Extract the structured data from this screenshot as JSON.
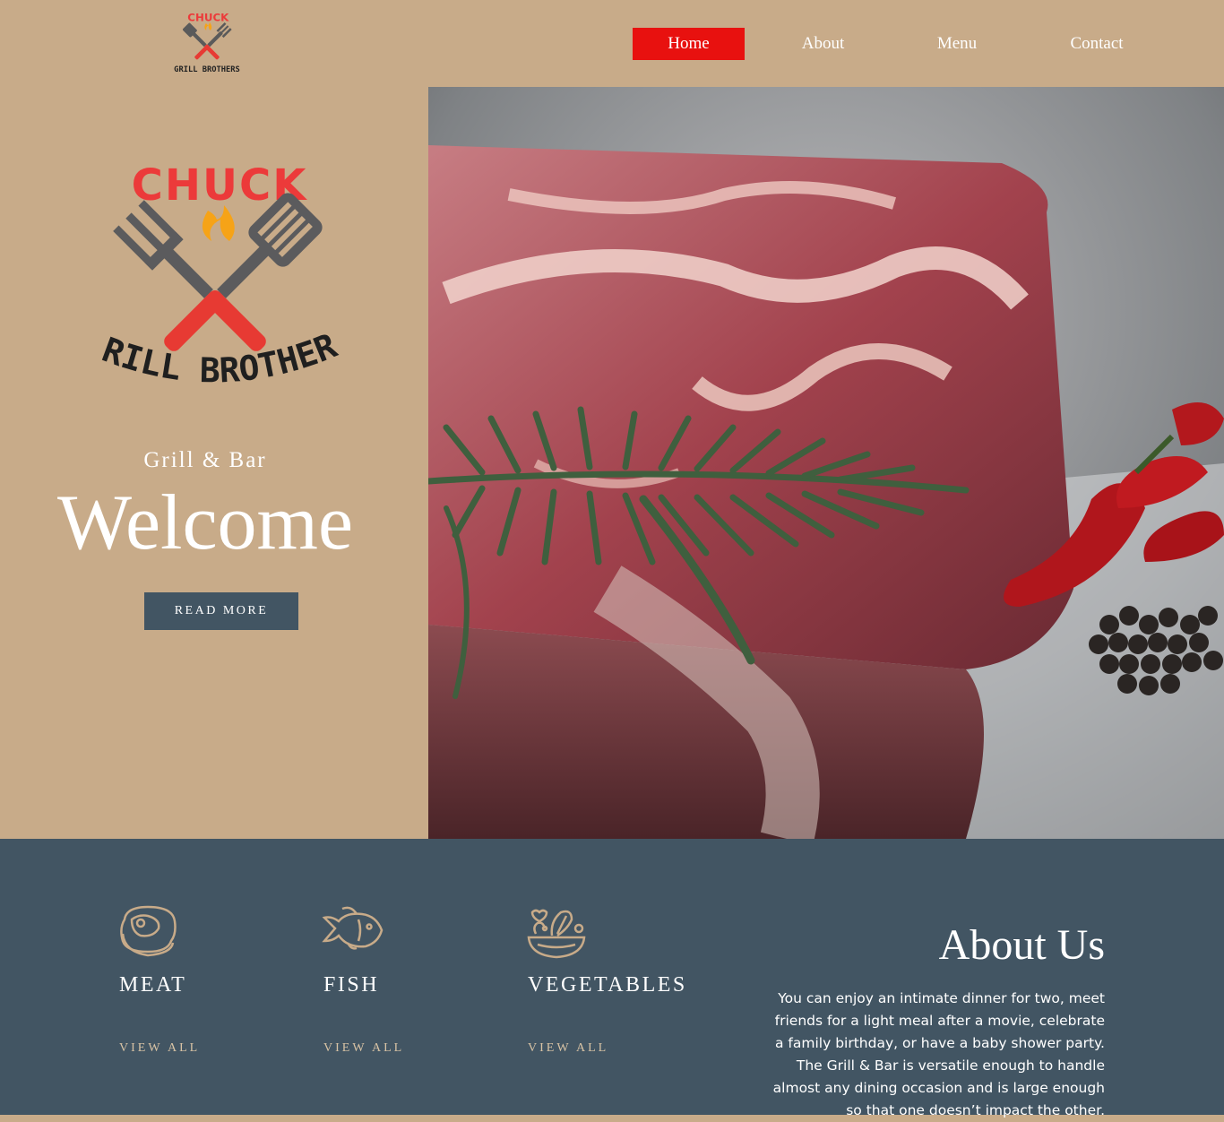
{
  "brand": {
    "logo_top": "CHUCK",
    "logo_bottom": "GRILL BROTHERS"
  },
  "nav": {
    "items": [
      "Home",
      "About",
      "Menu",
      "Contact"
    ],
    "active": "Home"
  },
  "hero": {
    "tagline": "Grill & Bar",
    "title": "Welcome",
    "button": "READ MORE",
    "image_icon": "steak-photo"
  },
  "categories": [
    {
      "title": "MEAT",
      "link": "VIEW ALL",
      "icon": "steak-icon"
    },
    {
      "title": "FISH",
      "link": "VIEW ALL",
      "icon": "fish-icon"
    },
    {
      "title": "VEGETABLES",
      "link": "VIEW ALL",
      "icon": "salad-bowl-icon"
    }
  ],
  "about": {
    "title": "About Us",
    "text": "You can enjoy an intimate dinner for two, meet friends for a light meal after a movie, celebrate a family birthday, or have a baby shower party. The Grill & Bar is versatile enough to handle almost any dining occasion and is large enough so that one doesn’t impact the other."
  },
  "colors": {
    "tan": "#c8ab89",
    "slate": "#425563",
    "accent_red": "#e8110f",
    "cream": "#d8c3a5"
  }
}
